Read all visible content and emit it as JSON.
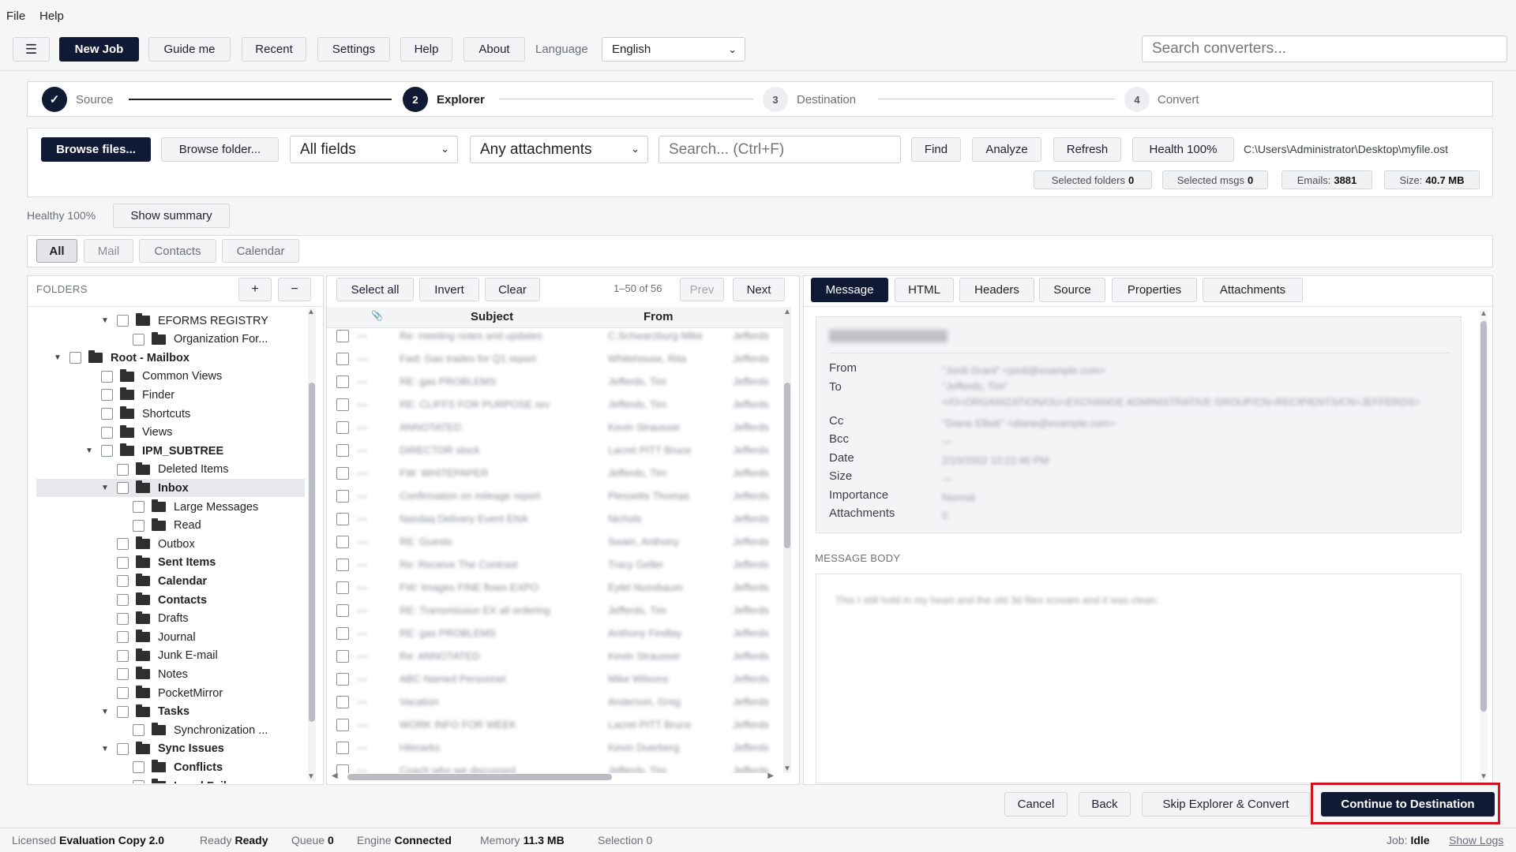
{
  "menubar": {
    "file": "File",
    "help": "Help"
  },
  "toolbar": {
    "new_job": "New Job",
    "guide_me": "Guide me",
    "recent": "Recent",
    "settings": "Settings",
    "help": "Help",
    "about": "About",
    "language_label": "Language",
    "language_value": "English",
    "search_placeholder": "Search converters..."
  },
  "steps": [
    {
      "num": "✓",
      "label": "Source"
    },
    {
      "num": "2",
      "label": "Explorer"
    },
    {
      "num": "3",
      "label": "Destination"
    },
    {
      "num": "4",
      "label": "Convert"
    }
  ],
  "actions": {
    "browse_files": "Browse files...",
    "browse_folder": "Browse folder...",
    "fields_select": "All fields",
    "attachments_select": "Any attachments",
    "search_placeholder": "Search... (Ctrl+F)",
    "find": "Find",
    "analyze": "Analyze",
    "refresh": "Refresh",
    "health": "Health 100%",
    "path": "C:\\Users\\Administrator\\Desktop\\myfile.ost"
  },
  "stats": {
    "selected_folders_label": "Selected folders",
    "selected_folders": "0",
    "selected_msgs_label": "Selected msgs",
    "selected_msgs": "0",
    "emails_label": "Emails:",
    "emails": "3881",
    "size_label": "Size:",
    "size": "40.7 MB"
  },
  "health": {
    "text": "Healthy 100%",
    "show_summary": "Show summary"
  },
  "filter_tabs": [
    "All",
    "Mail",
    "Contacts",
    "Calendar"
  ],
  "folders": {
    "title": "FOLDERS",
    "add": "+",
    "remove": "−",
    "items": [
      {
        "label": "EFORMS REGISTRY",
        "level": 3,
        "toggle": "▼",
        "bold": false
      },
      {
        "label": "Organization For...",
        "level": 4,
        "toggle": "",
        "bold": false
      },
      {
        "label": "Root - Mailbox",
        "level": 1,
        "toggle": "▼",
        "bold": true
      },
      {
        "label": "Common Views",
        "level": 2,
        "toggle": "",
        "bold": false
      },
      {
        "label": "Finder",
        "level": 2,
        "toggle": "",
        "bold": false
      },
      {
        "label": "Shortcuts",
        "level": 2,
        "toggle": "",
        "bold": false
      },
      {
        "label": "Views",
        "level": 2,
        "toggle": "",
        "bold": false
      },
      {
        "label": "IPM_SUBTREE",
        "level": 2,
        "toggle": "▼",
        "bold": true
      },
      {
        "label": "Deleted Items",
        "level": 3,
        "toggle": "",
        "bold": false
      },
      {
        "label": "Inbox",
        "level": 3,
        "toggle": "▼",
        "bold": true,
        "selected": true
      },
      {
        "label": "Large Messages",
        "level": 4,
        "toggle": "",
        "bold": false
      },
      {
        "label": "Read",
        "level": 4,
        "toggle": "",
        "bold": false
      },
      {
        "label": "Outbox",
        "level": 3,
        "toggle": "",
        "bold": false
      },
      {
        "label": "Sent Items",
        "level": 3,
        "toggle": "",
        "bold": true
      },
      {
        "label": "Calendar",
        "level": 3,
        "toggle": "",
        "bold": true
      },
      {
        "label": "Contacts",
        "level": 3,
        "toggle": "",
        "bold": true
      },
      {
        "label": "Drafts",
        "level": 3,
        "toggle": "",
        "bold": false
      },
      {
        "label": "Journal",
        "level": 3,
        "toggle": "",
        "bold": false
      },
      {
        "label": "Junk E-mail",
        "level": 3,
        "toggle": "",
        "bold": false
      },
      {
        "label": "Notes",
        "level": 3,
        "toggle": "",
        "bold": false
      },
      {
        "label": "PocketMirror",
        "level": 3,
        "toggle": "",
        "bold": false
      },
      {
        "label": "Tasks",
        "level": 3,
        "toggle": "▼",
        "bold": true
      },
      {
        "label": "Synchronization ...",
        "level": 4,
        "toggle": "",
        "bold": false
      },
      {
        "label": "Sync Issues",
        "level": 3,
        "toggle": "▼",
        "bold": true
      },
      {
        "label": "Conflicts",
        "level": 4,
        "toggle": "",
        "bold": true
      },
      {
        "label": "Local Failures",
        "level": 4,
        "toggle": "",
        "bold": true
      }
    ]
  },
  "messages": {
    "select_all": "Select all",
    "invert": "Invert",
    "clear": "Clear",
    "range": "1–50 of 56",
    "prev": "Prev",
    "next": "Next",
    "col_subject": "Subject",
    "col_from": "From"
  },
  "preview": {
    "tabs": [
      "Message",
      "HTML",
      "Headers",
      "Source",
      "Properties",
      "Attachments"
    ],
    "fields": [
      "From",
      "To",
      "Cc",
      "Bcc",
      "Date",
      "Size",
      "Importance",
      "Attachments"
    ],
    "body_label": "MESSAGE BODY"
  },
  "footer_buttons": {
    "cancel": "Cancel",
    "back": "Back",
    "skip": "Skip Explorer & Convert",
    "continue": "Continue to Destination"
  },
  "statusbar": {
    "licensed_label": "Licensed",
    "licensed": "Evaluation Copy 2.0",
    "ready_label": "Ready",
    "ready": "Ready",
    "queue_label": "Queue",
    "queue": "0",
    "engine_label": "Engine",
    "engine": "Connected",
    "memory_label": "Memory",
    "memory": "11.3 MB",
    "selection": "Selection 0",
    "job_label": "Job:",
    "job": "Idle",
    "show_logs": "Show Logs"
  },
  "colors": {
    "accent": "#101a35",
    "highlight": "#d3111f"
  }
}
